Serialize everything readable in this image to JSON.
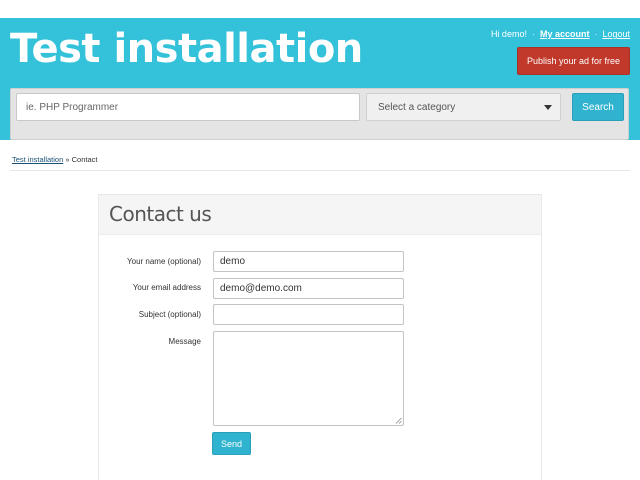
{
  "header": {
    "site_title": "Test installation",
    "greeting": "Hi demo!",
    "separator": "·",
    "my_account": "My account",
    "logout": "Logout",
    "publish_button": "Publish your ad for free",
    "accent_color": "#34c2da",
    "publish_color": "#c0392b"
  },
  "search": {
    "placeholder": "ie. PHP Programmer",
    "category_selected": "Select a category",
    "button": "Search"
  },
  "breadcrumb": {
    "home": "Test installation",
    "separator": "»",
    "current": "Contact"
  },
  "contact": {
    "title": "Contact us",
    "fields": {
      "name": {
        "label": "Your name (optional)",
        "value": "demo"
      },
      "email": {
        "label": "Your email address",
        "value": "demo@demo.com"
      },
      "subject": {
        "label": "Subject (optional)",
        "value": ""
      },
      "message": {
        "label": "Message",
        "value": ""
      }
    },
    "send_button": "Send"
  }
}
